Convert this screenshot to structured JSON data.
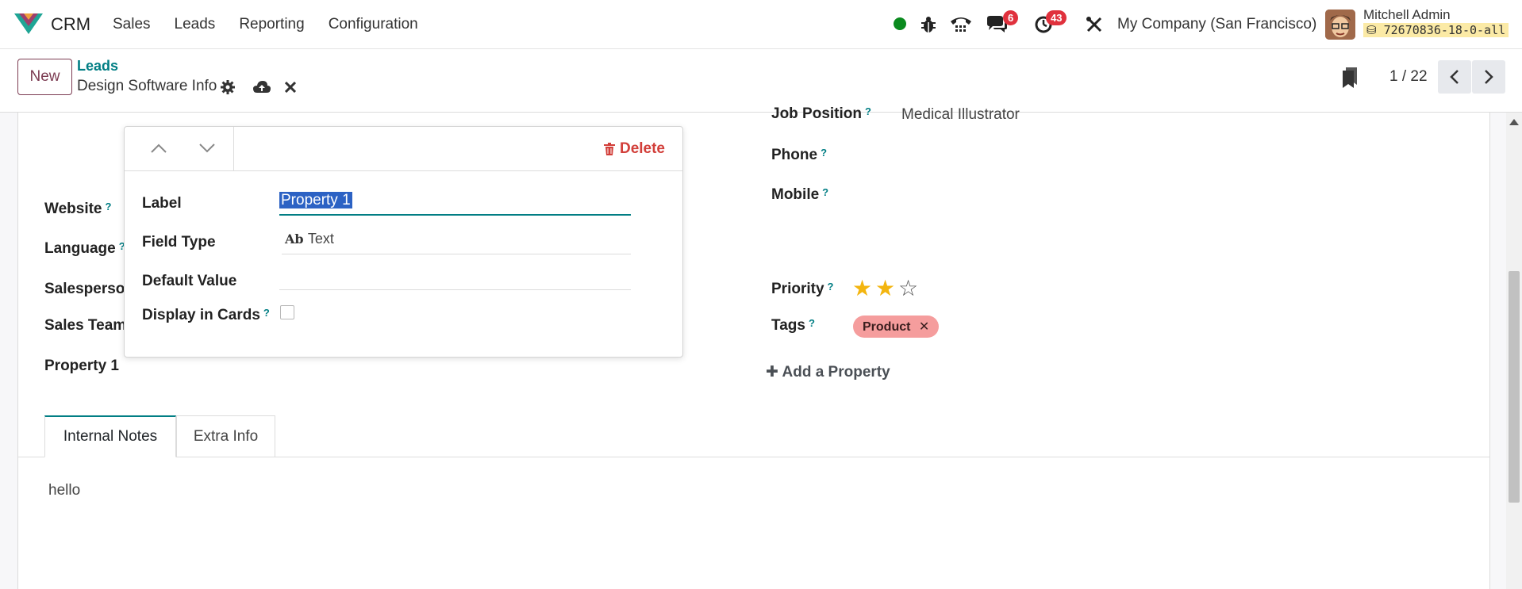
{
  "navbar": {
    "app_name": "CRM",
    "menu": [
      "Sales",
      "Leads",
      "Reporting",
      "Configuration"
    ],
    "messages_badge": "6",
    "activities_badge": "43",
    "company": "My Company (San Francisco)",
    "user_name": "Mitchell Admin",
    "database": "72670836-18-0-all",
    "colors": {
      "status_online": "#0a8a1e",
      "badge": "#e0313d",
      "brand": "#017e84"
    }
  },
  "control_panel": {
    "new_label": "New",
    "breadcrumb_parent": "Leads",
    "record_title": "Design Software Info",
    "pager": "1 / 22"
  },
  "form": {
    "left": {
      "website_label": "Website",
      "language_label": "Language",
      "salesperson_label": "Salesperson",
      "sales_team_label": "Sales Team",
      "property1_label": "Property 1"
    },
    "right": {
      "job_position_label": "Job Position",
      "job_position_value": "Medical Illustrator",
      "phone_label": "Phone",
      "mobile_label": "Mobile",
      "priority_label": "Priority",
      "priority_stars": 2,
      "priority_max": 3,
      "tags_label": "Tags",
      "tag": "Product",
      "add_property": "Add a Property"
    },
    "help_mark": "?"
  },
  "tabs": [
    {
      "label": "Internal Notes",
      "active": true
    },
    {
      "label": "Extra Info",
      "active": false
    }
  ],
  "notes": {
    "text": "hello"
  },
  "property_popover": {
    "delete_label": "Delete",
    "label_label": "Label",
    "label_value": "Property 1",
    "field_type_label": "Field Type",
    "field_type_icon": "Ab",
    "field_type_value": "Text",
    "default_value_label": "Default Value",
    "display_in_cards_label": "Display in Cards",
    "display_in_cards_checked": false
  }
}
